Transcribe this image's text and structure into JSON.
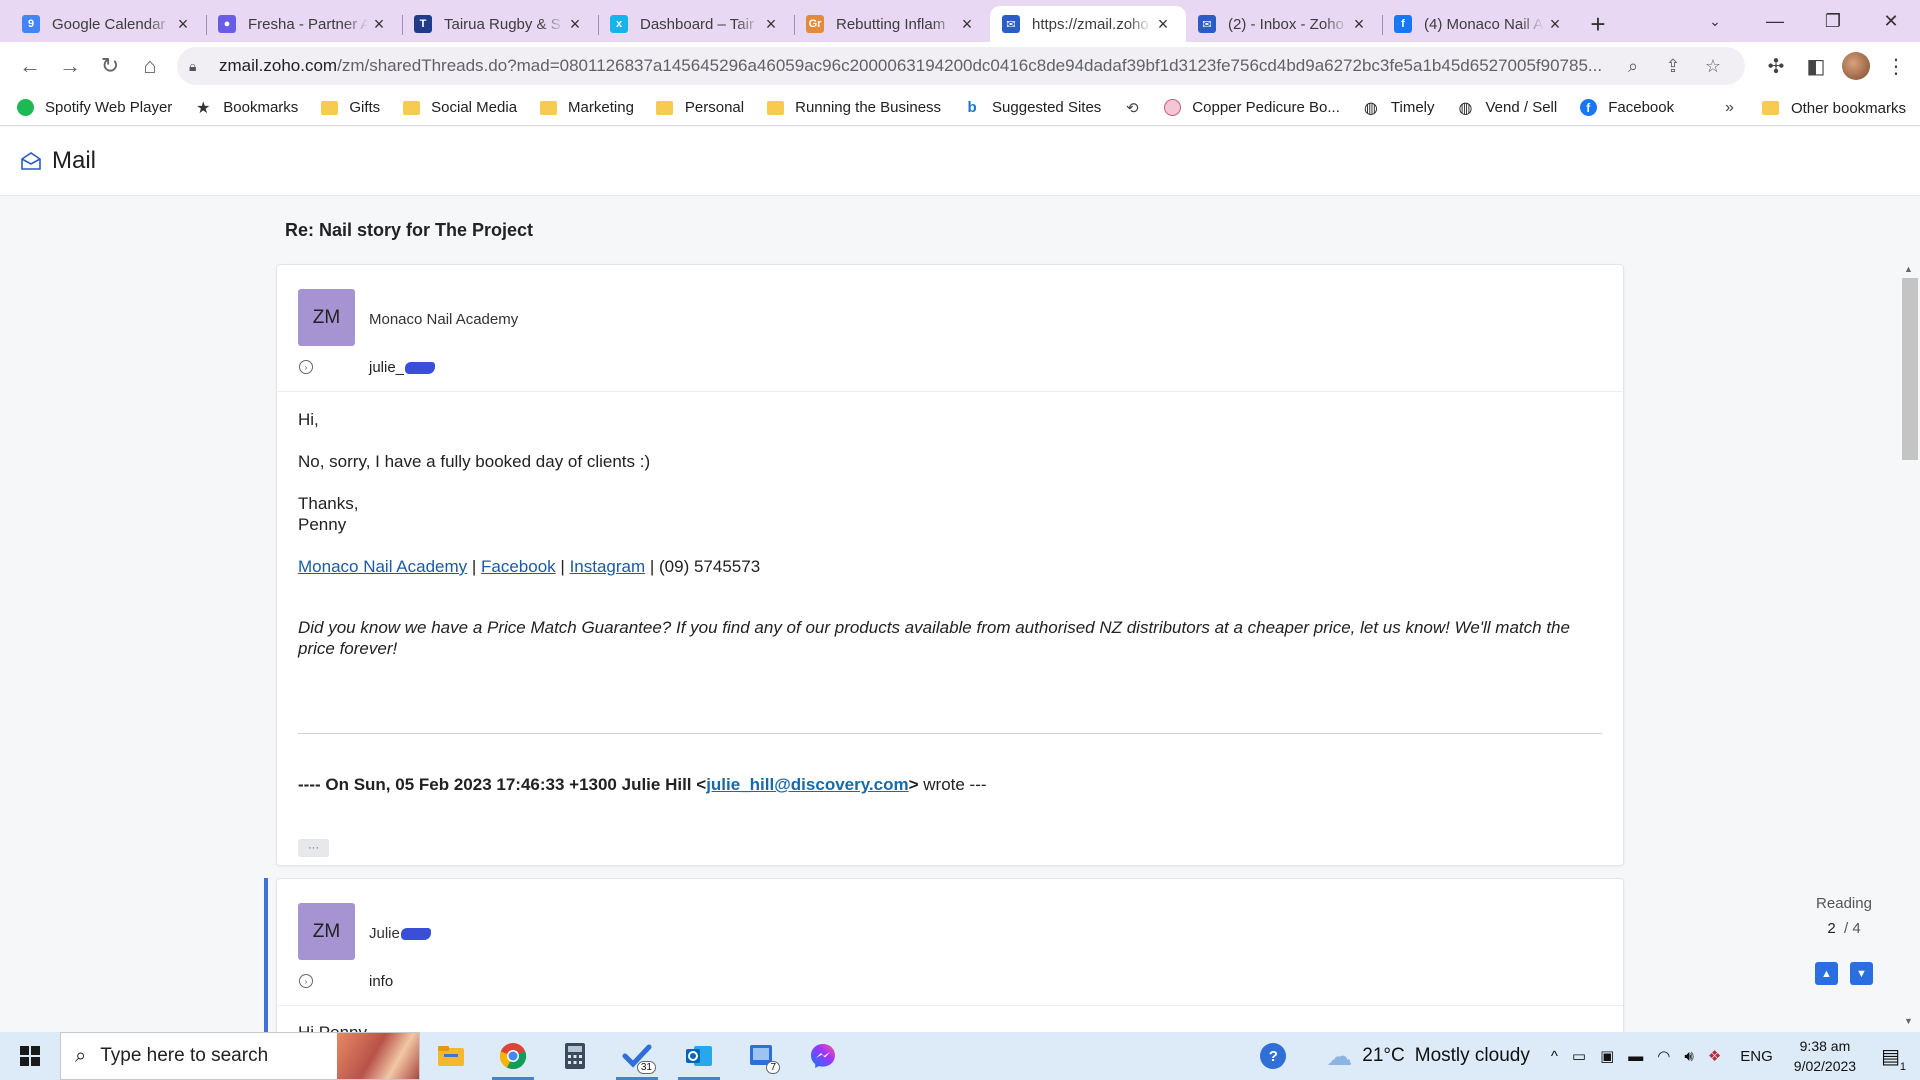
{
  "browser": {
    "tabs": [
      {
        "title": "Google Calendar",
        "color": "#4285f4",
        "glyph": "9"
      },
      {
        "title": "Fresha - Partner A",
        "color": "#6b5ce7",
        "glyph": "●"
      },
      {
        "title": "Tairua Rugby & S",
        "color": "#1f3b8a",
        "glyph": "T"
      },
      {
        "title": "Dashboard – Tair",
        "color": "#13b5ea",
        "glyph": "x"
      },
      {
        "title": "Rebutting Inflam",
        "color": "#e28b3c",
        "glyph": "Gr"
      },
      {
        "title": "https://zmail.zoho",
        "color": "#2c5cc5",
        "glyph": "✉",
        "active": true
      },
      {
        "title": "(2) - Inbox - Zoho",
        "color": "#2c5cc5",
        "glyph": "✉"
      },
      {
        "title": "(4) Monaco Nail A",
        "color": "#1877f2",
        "glyph": "f"
      }
    ],
    "url_host": "zmail.zoho.com",
    "url_path": "/zm/sharedThreads.do?mad=0801126837a145645296a46059ac96c2000063194200dc0416c8de94dadaf39bf1d3123fe756cd4bd9a6272bc3fe5a1b45d6527005f90785...",
    "bookmarks": [
      {
        "label": "Spotify Web Player",
        "icon": "spotify-icon"
      },
      {
        "label": "Bookmarks",
        "icon": "star-icon"
      },
      {
        "label": "Gifts",
        "icon": "folder-icon"
      },
      {
        "label": "Social Media",
        "icon": "folder-icon"
      },
      {
        "label": "Marketing",
        "icon": "folder-icon"
      },
      {
        "label": "Personal",
        "icon": "folder-icon"
      },
      {
        "label": "Running the Business",
        "icon": "folder-icon"
      },
      {
        "label": "Suggested Sites",
        "icon": "bing-icon"
      },
      {
        "label": "",
        "icon": "history-icon"
      },
      {
        "label": "Copper Pedicure Bo...",
        "icon": "site-icon"
      },
      {
        "label": "Timely",
        "icon": "globe-icon"
      },
      {
        "label": "Vend / Sell",
        "icon": "globe-icon"
      },
      {
        "label": "Facebook",
        "icon": "facebook-icon"
      }
    ],
    "more_bookmarks": "»",
    "other_bookmarks": "Other bookmarks"
  },
  "app": {
    "name": "Mail"
  },
  "thread": {
    "subject": "Re: Nail story for The Project",
    "messages": [
      {
        "avatar": "ZM",
        "sender": "Monaco Nail Academy",
        "recipient": "julie_",
        "greeting": "Hi,",
        "body": "No, sorry, I have a fully booked day of clients :)",
        "signoff": "Thanks,",
        "signature_name": "Penny",
        "links": {
          "academy": "Monaco Nail Academy",
          "facebook": "Facebook",
          "instagram": "Instagram",
          "sep": " | ",
          "phone": " | (09) 5745573"
        },
        "promo": "Did you know we have a Price Match Guarantee? If you find any of our products available from authorised NZ distributors at a cheaper price, let us know! We'll match the price forever!",
        "quote": {
          "prefix": "---- On Sun, 05 Feb 2023 17:46:33 +1300 ",
          "name": "Julie Hill",
          "open": " <",
          "email": "julie_hill@discovery.com",
          "close": ">",
          "suffix": " wrote ---"
        },
        "more_label": "···"
      },
      {
        "avatar": "ZM",
        "sender": "Julie",
        "recipient": "info",
        "greeting": "Hi Penny"
      }
    ]
  },
  "reading": {
    "label": "Reading",
    "current": "2",
    "total": "/ 4"
  },
  "taskbar": {
    "search_placeholder": "Type here to search",
    "todo_badge": "31",
    "teams_badge": "7",
    "temperature": "21°C",
    "weather": "Mostly cloudy",
    "language": "ENG",
    "time": "9:38 am",
    "date": "9/02/2023",
    "notifications": "1"
  }
}
